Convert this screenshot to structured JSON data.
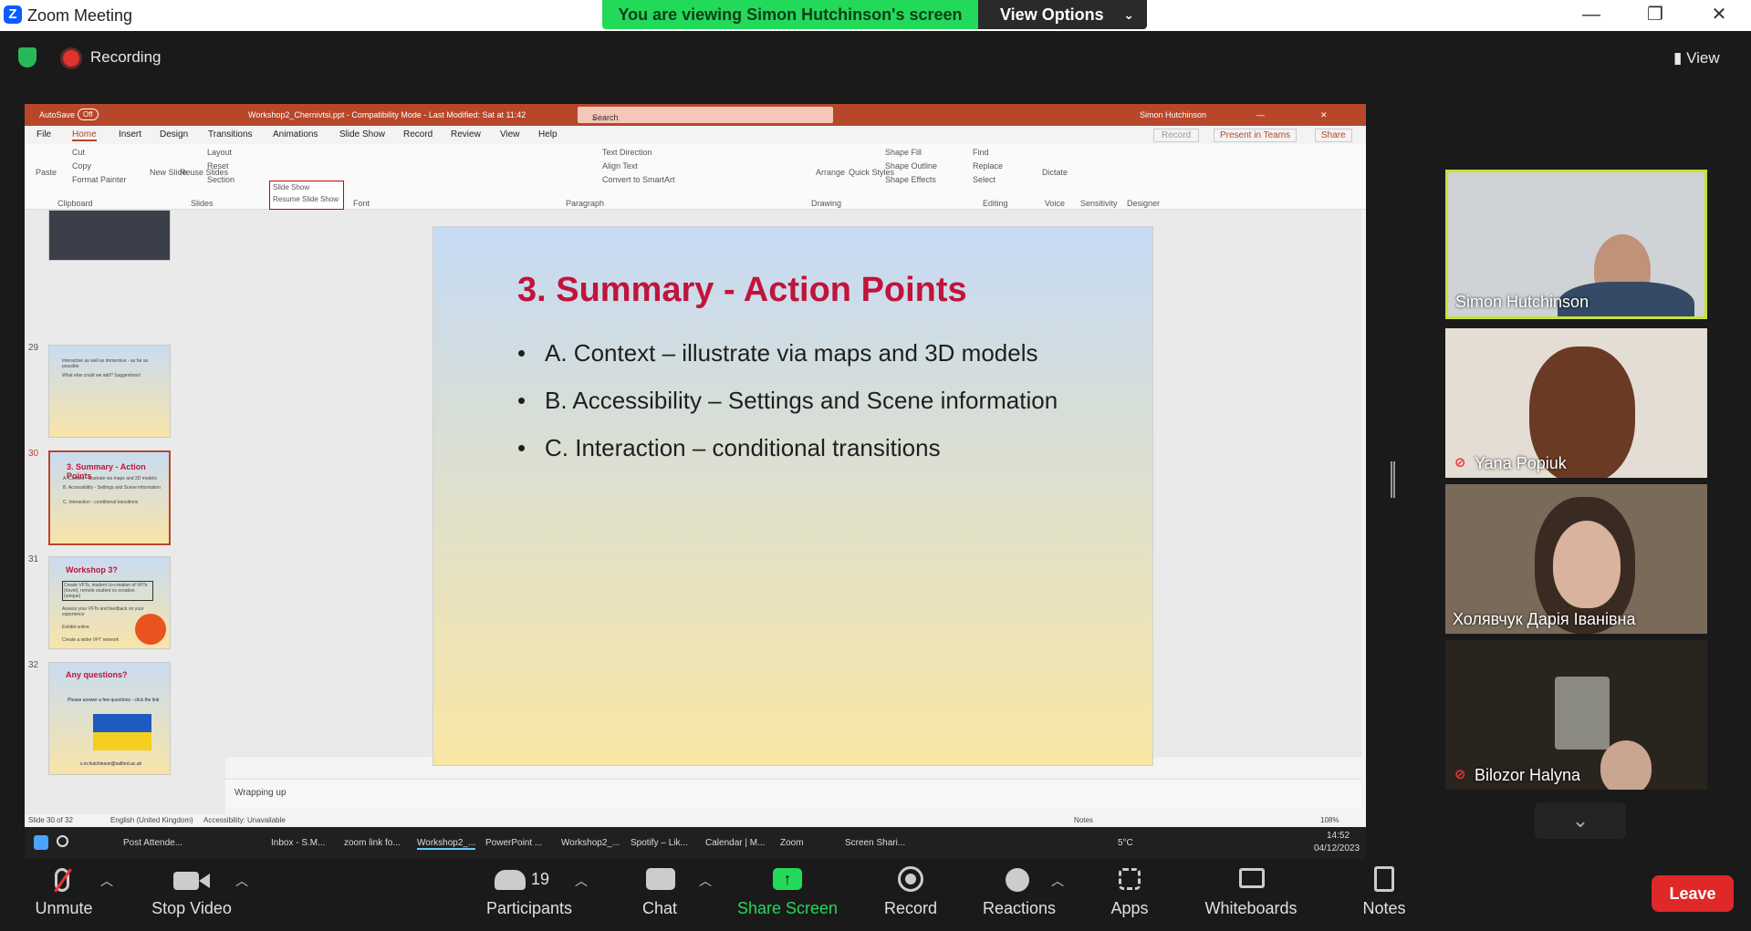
{
  "window": {
    "app_title": "Zoom Meeting",
    "viewing_banner": "You are viewing Simon Hutchinson's screen",
    "view_options": "View Options"
  },
  "top": {
    "recording": "Recording",
    "view": "View"
  },
  "ppt": {
    "autosave": "AutoSave",
    "autosave_state": "Off",
    "filename": "Workshop2_Chernivtsi.ppt - Compatibility Mode - Last Modified: Sat at 11:42",
    "search": "Search",
    "user": "Simon Hutchinson",
    "menu": [
      "File",
      "Home",
      "Insert",
      "Design",
      "Transitions",
      "Animations",
      "Slide Show",
      "Record",
      "Review",
      "View",
      "Help"
    ],
    "record_btn": "Record",
    "present_btn": "Present in Teams",
    "share_btn": "Share",
    "ribbon": {
      "paste": "Paste",
      "cut": "Cut",
      "copy": "Copy",
      "format_painter": "Format Painter",
      "clipboard": "Clipboard",
      "new_slide": "New Slide",
      "reuse": "Reuse Slides",
      "layout": "Layout",
      "reset": "Reset",
      "section": "Section",
      "slides": "Slides",
      "font": "Font",
      "paragraph": "Paragraph",
      "text_direction": "Text Direction",
      "align_text": "Align Text",
      "convert": "Convert to SmartArt",
      "arrange": "Arrange",
      "quick_styles": "Quick Styles",
      "shape_fill": "Shape Fill",
      "shape_outline": "Shape Outline",
      "shape_effects": "Shape Effects",
      "drawing": "Drawing",
      "find": "Find",
      "replace": "Replace",
      "select": "Select",
      "editing": "Editing",
      "dictate": "Dictate",
      "voice": "Voice",
      "sensitivity": "Sensitivity",
      "designer": "Designer",
      "slideshow_popup": "Slide Show",
      "resume": "Resume Slide Show"
    },
    "thumbs": [
      {
        "num": "29",
        "title": "",
        "lines": [
          "Interactive as well as immersive - as far as possible",
          "What else could we add? Suggestions!"
        ]
      },
      {
        "num": "30",
        "title": "3. Summary - Action Points",
        "lines": [
          "A. Context - illustrate via maps and 3D models",
          "B. Accessibility - Settings and Scene information",
          "C. Interaction - conditional transitions"
        ]
      },
      {
        "num": "31",
        "title": "Workshop 3?",
        "lines": [
          "Create VFTs, student co-creation of VFTs (novel), remote student co-creation (unique)",
          "Assess your VFTs and feedback on your experience",
          "Exhibit online",
          "Create a wider VFT network"
        ]
      },
      {
        "num": "32",
        "title": "Any questions?",
        "lines": [
          "Please answer a few questions - click the link",
          "s.m.hutchinson@salford.ac.uk"
        ]
      }
    ],
    "slide": {
      "title": "3. Summary - Action Points",
      "bullets": [
        "A. Context – illustrate via maps and 3D models",
        "B. Accessibility – Settings and Scene information",
        "C. Interaction – conditional transitions"
      ]
    },
    "notes": "Wrapping up",
    "status": {
      "slide": "Slide 30 of 32",
      "language": "English (United Kingdom)",
      "accessibility": "Accessibility: Unavailable",
      "notes": "Notes",
      "zoom": "108%"
    }
  },
  "taskbar": {
    "items": [
      "Post Attende...",
      "Inbox - S.M...",
      "zoom link fo...",
      "Workshop2_...",
      "PowerPoint ...",
      "Workshop2_...",
      "Spotify – Lik...",
      "Calendar | M...",
      "Zoom",
      "Screen Shari..."
    ],
    "temp": "5°C",
    "time": "14:52",
    "date": "04/12/2023"
  },
  "participants": [
    {
      "name": "Simon Hutchinson",
      "muted": false
    },
    {
      "name": "Yana Popiuk",
      "muted": true
    },
    {
      "name": "Холявчук Дарія Іванівна",
      "muted": false
    },
    {
      "name": "Bilozor Halyna",
      "muted": true
    }
  ],
  "toolbar": {
    "unmute": "Unmute",
    "stop_video": "Stop Video",
    "participants": "Participants",
    "participants_count": "19",
    "chat": "Chat",
    "share_screen": "Share Screen",
    "record": "Record",
    "reactions": "Reactions",
    "apps": "Apps",
    "whiteboards": "Whiteboards",
    "notes": "Notes",
    "leave": "Leave"
  },
  "colors": {
    "zoom_blue": "#0b5cff",
    "share_green": "#23d959",
    "ppt_accent": "#b7472a",
    "slide_title": "#c0143c",
    "leave_red": "#e02828"
  }
}
